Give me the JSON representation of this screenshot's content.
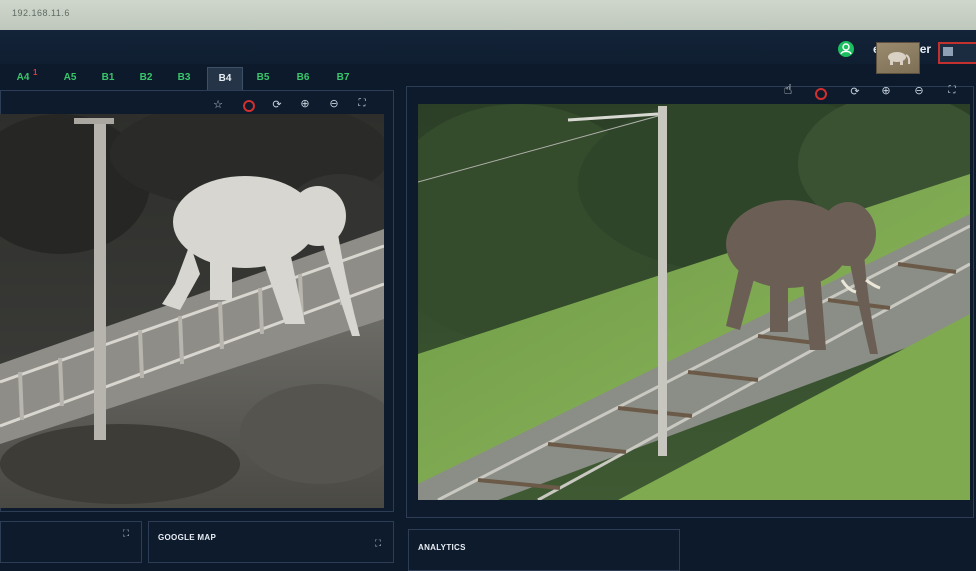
{
  "browser": {
    "address": "192.168.11.6"
  },
  "header": {
    "user_name": "eEye User"
  },
  "tabs": [
    {
      "label": "A4",
      "badge": "1"
    },
    {
      "label": "A5"
    },
    {
      "label": "B1"
    },
    {
      "label": "B2"
    },
    {
      "label": "B3"
    },
    {
      "label": "B4",
      "active": true
    },
    {
      "label": "B5"
    },
    {
      "label": "B6"
    },
    {
      "label": "B7"
    }
  ],
  "camera_controls": {
    "left": [
      "star-icon",
      "record-icon",
      "refresh-icon",
      "zoom-in-icon",
      "zoom-out-icon",
      "fullscreen-icon"
    ],
    "right": [
      "pointer-icon",
      "record-icon",
      "refresh-icon",
      "zoom-in-icon",
      "zoom-out-icon",
      "fullscreen-icon"
    ]
  },
  "bottom_panels": {
    "map_title": "GOOGLE MAP",
    "analytics_title": "ANALYTICS"
  },
  "colors": {
    "accent_green": "#39c66a",
    "record_red": "#d22f2f",
    "background": "#0d1a2b"
  }
}
